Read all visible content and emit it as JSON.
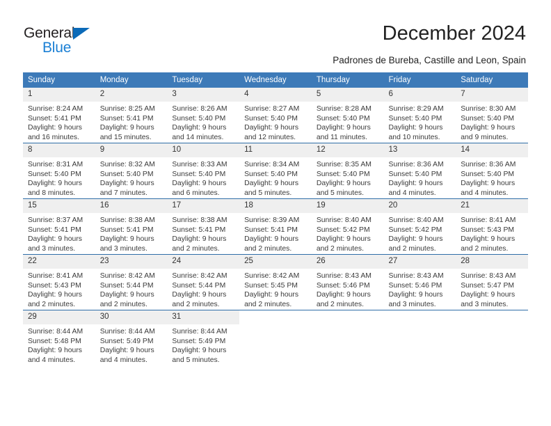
{
  "brand": {
    "name_part1": "General",
    "name_part2": "Blue",
    "triangle_color": "#0b6ab8",
    "blue_color": "#1a7fd4"
  },
  "header": {
    "title": "December 2024",
    "location": "Padrones de Bureba, Castille and Leon, Spain"
  },
  "theme": {
    "header_bg": "#3d7ab8",
    "header_text": "#ffffff",
    "daynum_bg": "#efefef",
    "week_rule": "#2e6da8",
    "body_bg": "#ffffff"
  },
  "weekdays": [
    "Sunday",
    "Monday",
    "Tuesday",
    "Wednesday",
    "Thursday",
    "Friday",
    "Saturday"
  ],
  "labels": {
    "sunrise_prefix": "Sunrise:",
    "sunset_prefix": "Sunset:",
    "daylight_prefix": "Daylight:"
  },
  "weeks": [
    [
      {
        "day": "1",
        "sunrise": "Sunrise: 8:24 AM",
        "sunset": "Sunset: 5:41 PM",
        "daylight_line1": "Daylight: 9 hours",
        "daylight_line2": "and 16 minutes."
      },
      {
        "day": "2",
        "sunrise": "Sunrise: 8:25 AM",
        "sunset": "Sunset: 5:41 PM",
        "daylight_line1": "Daylight: 9 hours",
        "daylight_line2": "and 15 minutes."
      },
      {
        "day": "3",
        "sunrise": "Sunrise: 8:26 AM",
        "sunset": "Sunset: 5:40 PM",
        "daylight_line1": "Daylight: 9 hours",
        "daylight_line2": "and 14 minutes."
      },
      {
        "day": "4",
        "sunrise": "Sunrise: 8:27 AM",
        "sunset": "Sunset: 5:40 PM",
        "daylight_line1": "Daylight: 9 hours",
        "daylight_line2": "and 12 minutes."
      },
      {
        "day": "5",
        "sunrise": "Sunrise: 8:28 AM",
        "sunset": "Sunset: 5:40 PM",
        "daylight_line1": "Daylight: 9 hours",
        "daylight_line2": "and 11 minutes."
      },
      {
        "day": "6",
        "sunrise": "Sunrise: 8:29 AM",
        "sunset": "Sunset: 5:40 PM",
        "daylight_line1": "Daylight: 9 hours",
        "daylight_line2": "and 10 minutes."
      },
      {
        "day": "7",
        "sunrise": "Sunrise: 8:30 AM",
        "sunset": "Sunset: 5:40 PM",
        "daylight_line1": "Daylight: 9 hours",
        "daylight_line2": "and 9 minutes."
      }
    ],
    [
      {
        "day": "8",
        "sunrise": "Sunrise: 8:31 AM",
        "sunset": "Sunset: 5:40 PM",
        "daylight_line1": "Daylight: 9 hours",
        "daylight_line2": "and 8 minutes."
      },
      {
        "day": "9",
        "sunrise": "Sunrise: 8:32 AM",
        "sunset": "Sunset: 5:40 PM",
        "daylight_line1": "Daylight: 9 hours",
        "daylight_line2": "and 7 minutes."
      },
      {
        "day": "10",
        "sunrise": "Sunrise: 8:33 AM",
        "sunset": "Sunset: 5:40 PM",
        "daylight_line1": "Daylight: 9 hours",
        "daylight_line2": "and 6 minutes."
      },
      {
        "day": "11",
        "sunrise": "Sunrise: 8:34 AM",
        "sunset": "Sunset: 5:40 PM",
        "daylight_line1": "Daylight: 9 hours",
        "daylight_line2": "and 5 minutes."
      },
      {
        "day": "12",
        "sunrise": "Sunrise: 8:35 AM",
        "sunset": "Sunset: 5:40 PM",
        "daylight_line1": "Daylight: 9 hours",
        "daylight_line2": "and 5 minutes."
      },
      {
        "day": "13",
        "sunrise": "Sunrise: 8:36 AM",
        "sunset": "Sunset: 5:40 PM",
        "daylight_line1": "Daylight: 9 hours",
        "daylight_line2": "and 4 minutes."
      },
      {
        "day": "14",
        "sunrise": "Sunrise: 8:36 AM",
        "sunset": "Sunset: 5:40 PM",
        "daylight_line1": "Daylight: 9 hours",
        "daylight_line2": "and 4 minutes."
      }
    ],
    [
      {
        "day": "15",
        "sunrise": "Sunrise: 8:37 AM",
        "sunset": "Sunset: 5:41 PM",
        "daylight_line1": "Daylight: 9 hours",
        "daylight_line2": "and 3 minutes."
      },
      {
        "day": "16",
        "sunrise": "Sunrise: 8:38 AM",
        "sunset": "Sunset: 5:41 PM",
        "daylight_line1": "Daylight: 9 hours",
        "daylight_line2": "and 3 minutes."
      },
      {
        "day": "17",
        "sunrise": "Sunrise: 8:38 AM",
        "sunset": "Sunset: 5:41 PM",
        "daylight_line1": "Daylight: 9 hours",
        "daylight_line2": "and 2 minutes."
      },
      {
        "day": "18",
        "sunrise": "Sunrise: 8:39 AM",
        "sunset": "Sunset: 5:41 PM",
        "daylight_line1": "Daylight: 9 hours",
        "daylight_line2": "and 2 minutes."
      },
      {
        "day": "19",
        "sunrise": "Sunrise: 8:40 AM",
        "sunset": "Sunset: 5:42 PM",
        "daylight_line1": "Daylight: 9 hours",
        "daylight_line2": "and 2 minutes."
      },
      {
        "day": "20",
        "sunrise": "Sunrise: 8:40 AM",
        "sunset": "Sunset: 5:42 PM",
        "daylight_line1": "Daylight: 9 hours",
        "daylight_line2": "and 2 minutes."
      },
      {
        "day": "21",
        "sunrise": "Sunrise: 8:41 AM",
        "sunset": "Sunset: 5:43 PM",
        "daylight_line1": "Daylight: 9 hours",
        "daylight_line2": "and 2 minutes."
      }
    ],
    [
      {
        "day": "22",
        "sunrise": "Sunrise: 8:41 AM",
        "sunset": "Sunset: 5:43 PM",
        "daylight_line1": "Daylight: 9 hours",
        "daylight_line2": "and 2 minutes."
      },
      {
        "day": "23",
        "sunrise": "Sunrise: 8:42 AM",
        "sunset": "Sunset: 5:44 PM",
        "daylight_line1": "Daylight: 9 hours",
        "daylight_line2": "and 2 minutes."
      },
      {
        "day": "24",
        "sunrise": "Sunrise: 8:42 AM",
        "sunset": "Sunset: 5:44 PM",
        "daylight_line1": "Daylight: 9 hours",
        "daylight_line2": "and 2 minutes."
      },
      {
        "day": "25",
        "sunrise": "Sunrise: 8:42 AM",
        "sunset": "Sunset: 5:45 PM",
        "daylight_line1": "Daylight: 9 hours",
        "daylight_line2": "and 2 minutes."
      },
      {
        "day": "26",
        "sunrise": "Sunrise: 8:43 AM",
        "sunset": "Sunset: 5:46 PM",
        "daylight_line1": "Daylight: 9 hours",
        "daylight_line2": "and 2 minutes."
      },
      {
        "day": "27",
        "sunrise": "Sunrise: 8:43 AM",
        "sunset": "Sunset: 5:46 PM",
        "daylight_line1": "Daylight: 9 hours",
        "daylight_line2": "and 3 minutes."
      },
      {
        "day": "28",
        "sunrise": "Sunrise: 8:43 AM",
        "sunset": "Sunset: 5:47 PM",
        "daylight_line1": "Daylight: 9 hours",
        "daylight_line2": "and 3 minutes."
      }
    ],
    [
      {
        "day": "29",
        "sunrise": "Sunrise: 8:44 AM",
        "sunset": "Sunset: 5:48 PM",
        "daylight_line1": "Daylight: 9 hours",
        "daylight_line2": "and 4 minutes."
      },
      {
        "day": "30",
        "sunrise": "Sunrise: 8:44 AM",
        "sunset": "Sunset: 5:49 PM",
        "daylight_line1": "Daylight: 9 hours",
        "daylight_line2": "and 4 minutes."
      },
      {
        "day": "31",
        "sunrise": "Sunrise: 8:44 AM",
        "sunset": "Sunset: 5:49 PM",
        "daylight_line1": "Daylight: 9 hours",
        "daylight_line2": "and 5 minutes."
      },
      {
        "day": "",
        "sunrise": "",
        "sunset": "",
        "daylight_line1": "",
        "daylight_line2": ""
      },
      {
        "day": "",
        "sunrise": "",
        "sunset": "",
        "daylight_line1": "",
        "daylight_line2": ""
      },
      {
        "day": "",
        "sunrise": "",
        "sunset": "",
        "daylight_line1": "",
        "daylight_line2": ""
      },
      {
        "day": "",
        "sunrise": "",
        "sunset": "",
        "daylight_line1": "",
        "daylight_line2": ""
      }
    ]
  ]
}
